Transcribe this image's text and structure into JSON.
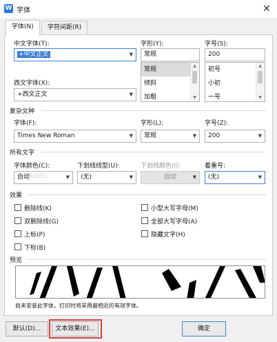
{
  "window": {
    "title": "字体",
    "app_icon_letter": "W",
    "close_glyph": "✕"
  },
  "tabs": [
    {
      "label": "字体(N)",
      "active": true
    },
    {
      "label": "字符间距(R)",
      "active": false
    }
  ],
  "chinese_font": {
    "label": "中文字体(T):",
    "value": "+中文正文"
  },
  "western_font": {
    "label": "西文字体(X):",
    "value": "+西文正文"
  },
  "style": {
    "label": "字形(Y):",
    "value": "常规",
    "options": [
      "常规",
      "倾斜",
      "加粗"
    ]
  },
  "size": {
    "label": "字号(S):",
    "value": "200",
    "options": [
      "初号",
      "小初",
      "一号"
    ]
  },
  "complex": {
    "section_title": "复杂文种",
    "font_label": "字体(F):",
    "font_value": "Times New Roman",
    "style_label": "字形(L):",
    "style_value": "常规",
    "size_label": "字号(Z):",
    "size_value": "200"
  },
  "all_text": {
    "section_title": "所有文字",
    "color_label": "字体颜色(C):",
    "color_value": "自动",
    "underline_label": "下划线线型(U):",
    "underline_value": "(无)",
    "underline_color_label": "下划线颜色(I):",
    "underline_color_value": "自动",
    "emphasis_label": "着重号:",
    "emphasis_value": "(无)"
  },
  "effects": {
    "section_title": "效果",
    "left": [
      "删除线(K)",
      "双删除线(G)",
      "上标(P)",
      "下标(B)"
    ],
    "right": [
      "小型大写字母(M)",
      "全部大写字母(A)",
      "隐藏文字(H)"
    ]
  },
  "preview": {
    "section_title": "预览",
    "note": "尚未安装此字体，打印时将采用最相近的有效字体。"
  },
  "buttons": {
    "default": "默认(D)...",
    "text_effects": "文本效果(E)...",
    "ok": "确定"
  },
  "watermark": "Baidu",
  "colors": {
    "highlight": "#3a7fd5",
    "annotation": "#d9403a"
  }
}
